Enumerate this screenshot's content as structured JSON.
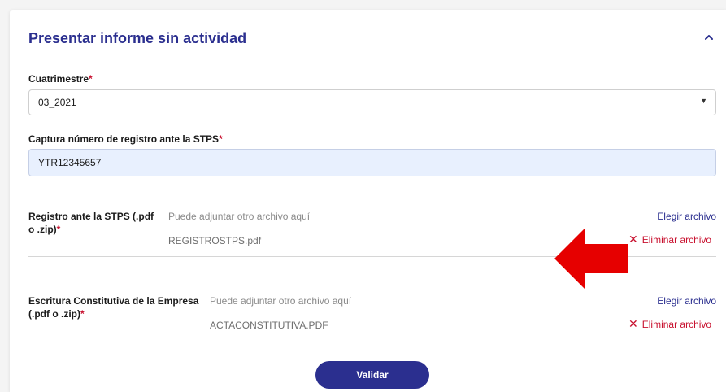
{
  "panel": {
    "title": "Presentar informe sin actividad",
    "collapse_icon": "chevron-up-icon"
  },
  "form": {
    "cuatrimestre": {
      "label": "Cuatrimestre",
      "required_mark": "*",
      "value": "03_2021"
    },
    "registro_numero": {
      "label": "Captura número de registro ante la STPS",
      "required_mark": "*",
      "value": "YTR12345657"
    },
    "files": [
      {
        "label": "Registro ante la STPS (.pdf o .zip)",
        "required_mark": "*",
        "hint": "Puede adjuntar otro archivo aquí",
        "file_name": "REGISTROSTPS.pdf",
        "choose_label": "Elegir archivo",
        "remove_label": "Eliminar archivo"
      },
      {
        "label": "Escritura Constitutiva de la Empresa (.pdf o .zip)",
        "required_mark": "*",
        "hint": "Puede adjuntar otro archivo aquí",
        "file_name": "ACTACONSTITUTIVA.PDF",
        "choose_label": "Elegir archivo",
        "remove_label": "Eliminar archivo"
      }
    ],
    "submit_label": "Validar"
  },
  "colors": {
    "primary": "#2b2f8f",
    "danger": "#c8102e",
    "arrow": "#e60000",
    "input_fill": "#e8f0fe"
  }
}
